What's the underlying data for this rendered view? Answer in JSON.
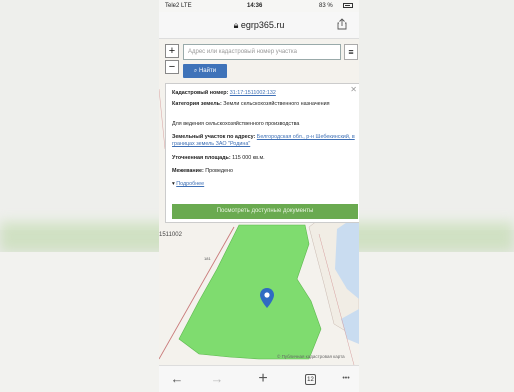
{
  "status_bar": {
    "carrier": "Tele2  LTE",
    "time": "14:36",
    "battery": "83 %"
  },
  "browser": {
    "url": "egrp365.ru",
    "tab_count": "12",
    "more": "•••"
  },
  "map": {
    "search_placeholder": "Адрес или кадастровый номер участка",
    "find_label": "Найти",
    "zoom_in": "+",
    "zoom_out": "−",
    "menu": "≡",
    "parcel_label": "1511002",
    "lot_number": "181",
    "credit": "© Публичная кадастровая карта"
  },
  "info_card": {
    "cadastral_label": "Кадастровый номер:",
    "cadastral_value": "31:17:1511002:132",
    "category_label": "Категория земель:",
    "category_value": "Земли сельскохозяйственного назначения",
    "purpose_value": "Для ведения сельскохозяйственного производства",
    "address_label": "Земельный участок по адресу:",
    "address_value": "Белгородская обл., р-н Шебекинский, в границах земель ЗАО \"Родина\"",
    "area_label": "Уточненная площадь:",
    "area_value": "115 000 кв.м.",
    "survey_label": "Межевание:",
    "survey_value": "Проведено",
    "details_link": "Подробнее",
    "docs_button": "Посмотреть доступные документы"
  },
  "colors": {
    "parcel": "#7fdc6f",
    "button_blue": "#3f73b9",
    "docs_green": "#6aaa50"
  }
}
